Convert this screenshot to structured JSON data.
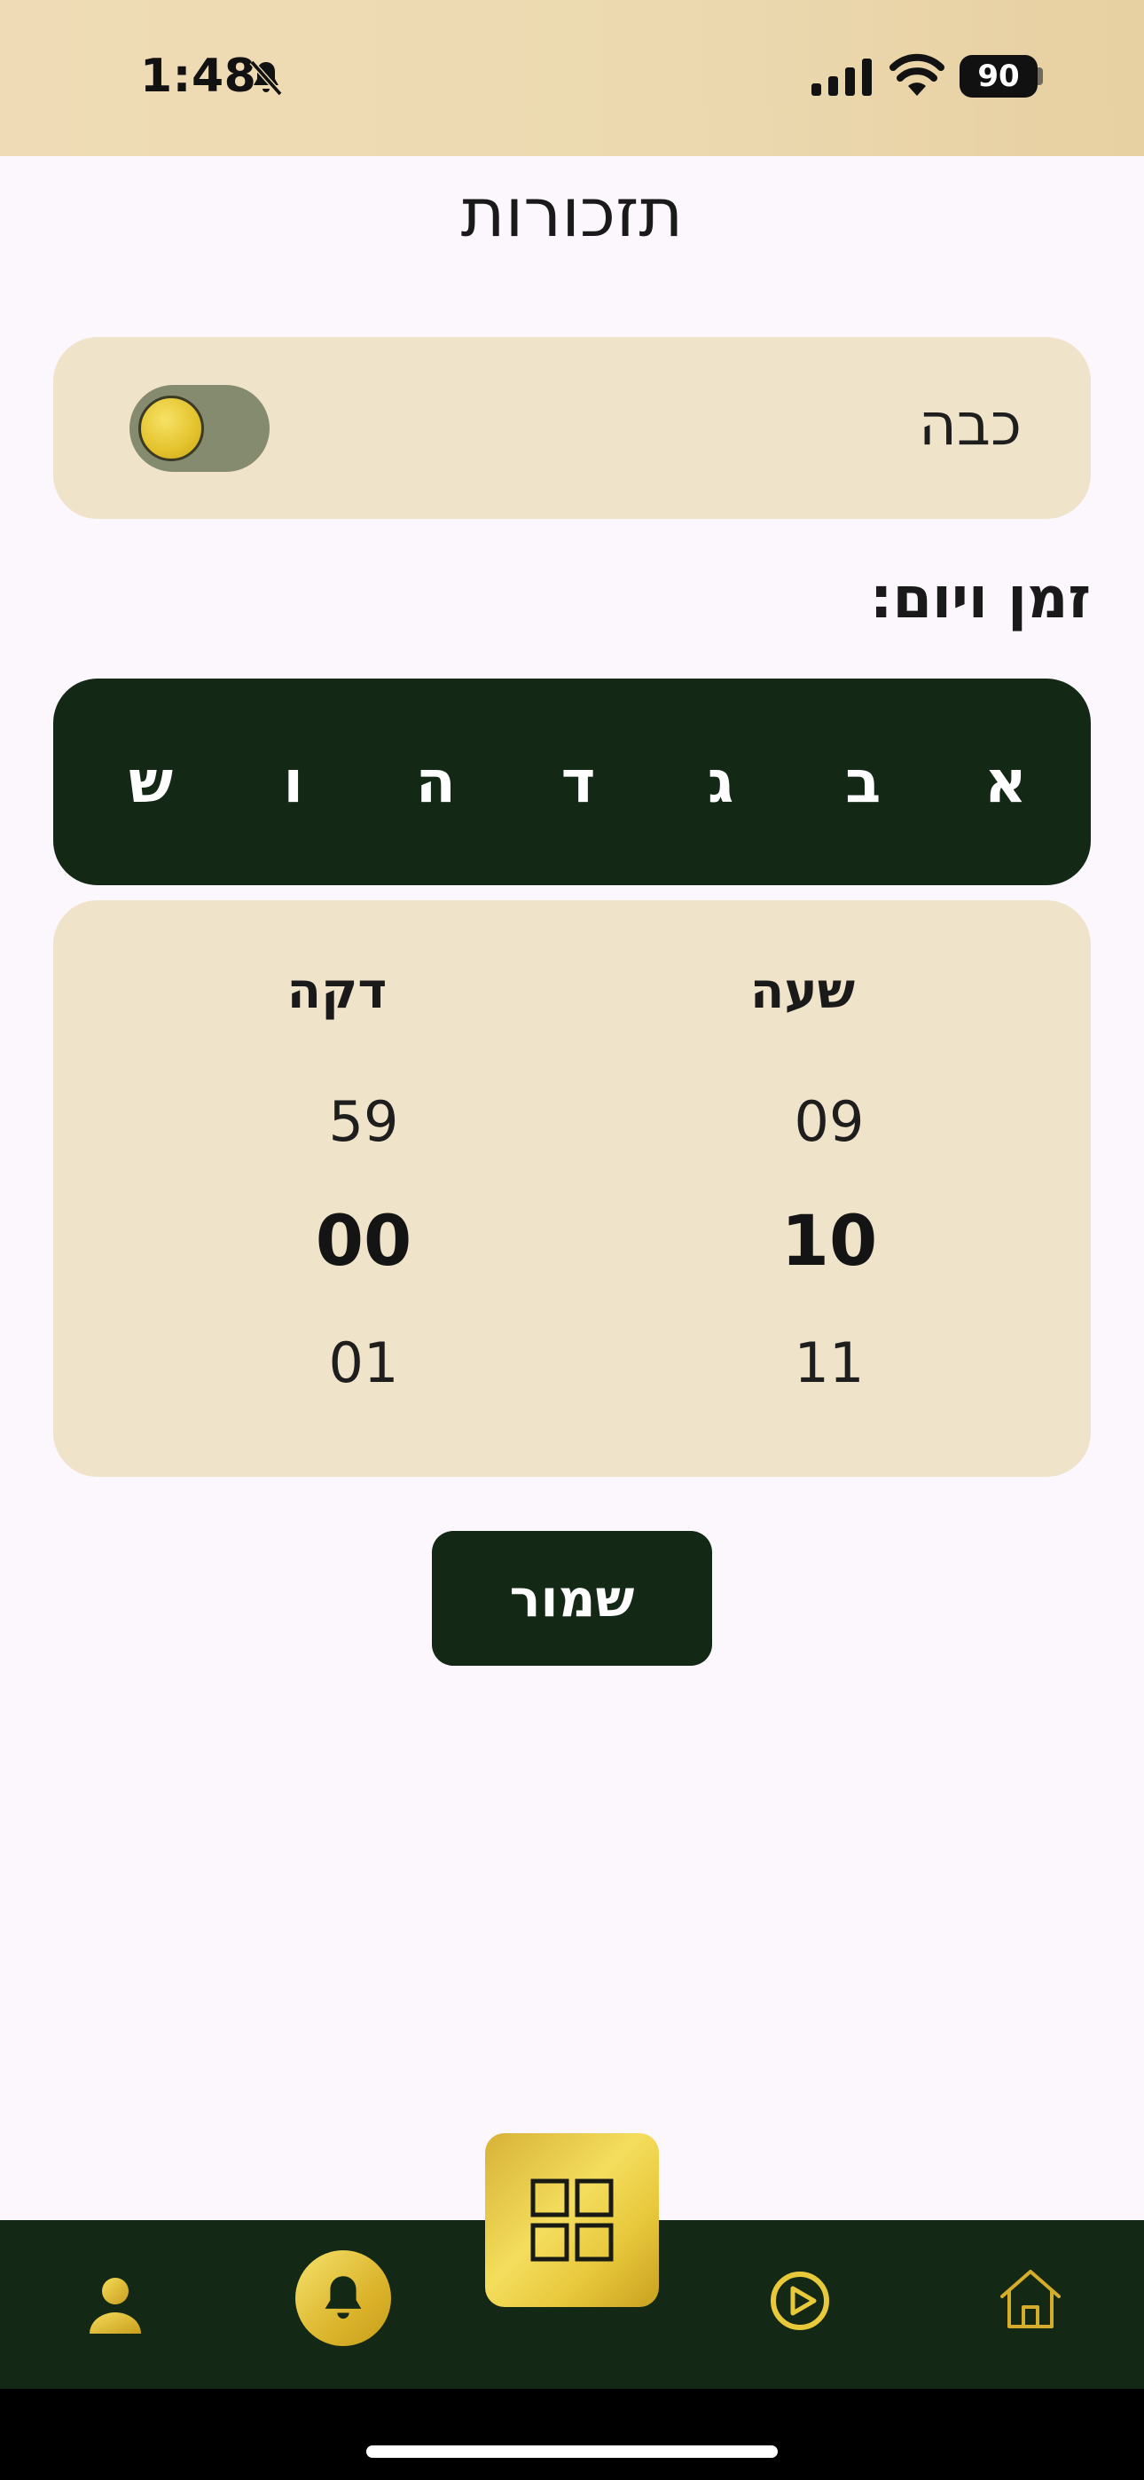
{
  "status_bar": {
    "time": "1:48",
    "battery": "90",
    "icons": [
      "bell-slash-icon",
      "signal-icon",
      "wifi-icon",
      "battery-icon"
    ]
  },
  "header": {
    "title": "תזכורות"
  },
  "toggle": {
    "label": "כבה",
    "state": "off"
  },
  "schedule": {
    "heading": "זמן ויום:",
    "days": [
      "א",
      "ב",
      "ג",
      "ד",
      "ה",
      "ו",
      "ש"
    ]
  },
  "time_picker": {
    "hour_label": "שעה",
    "minute_label": "דקה",
    "hours": [
      "09",
      "10",
      "11"
    ],
    "minutes": [
      "59",
      "00",
      "01"
    ],
    "selected_hour": "10",
    "selected_minute": "00"
  },
  "actions": {
    "save_label": "שמור"
  },
  "bottom_nav": {
    "items": [
      "person-icon",
      "bell-icon",
      "grid-icon",
      "play-circle-icon",
      "home-icon"
    ],
    "active": "bell-icon"
  },
  "colors": {
    "dark_green": "#142816",
    "beige_card": "#efe3c9",
    "gold": "#e3c22c",
    "background": "#fcf7fc"
  }
}
